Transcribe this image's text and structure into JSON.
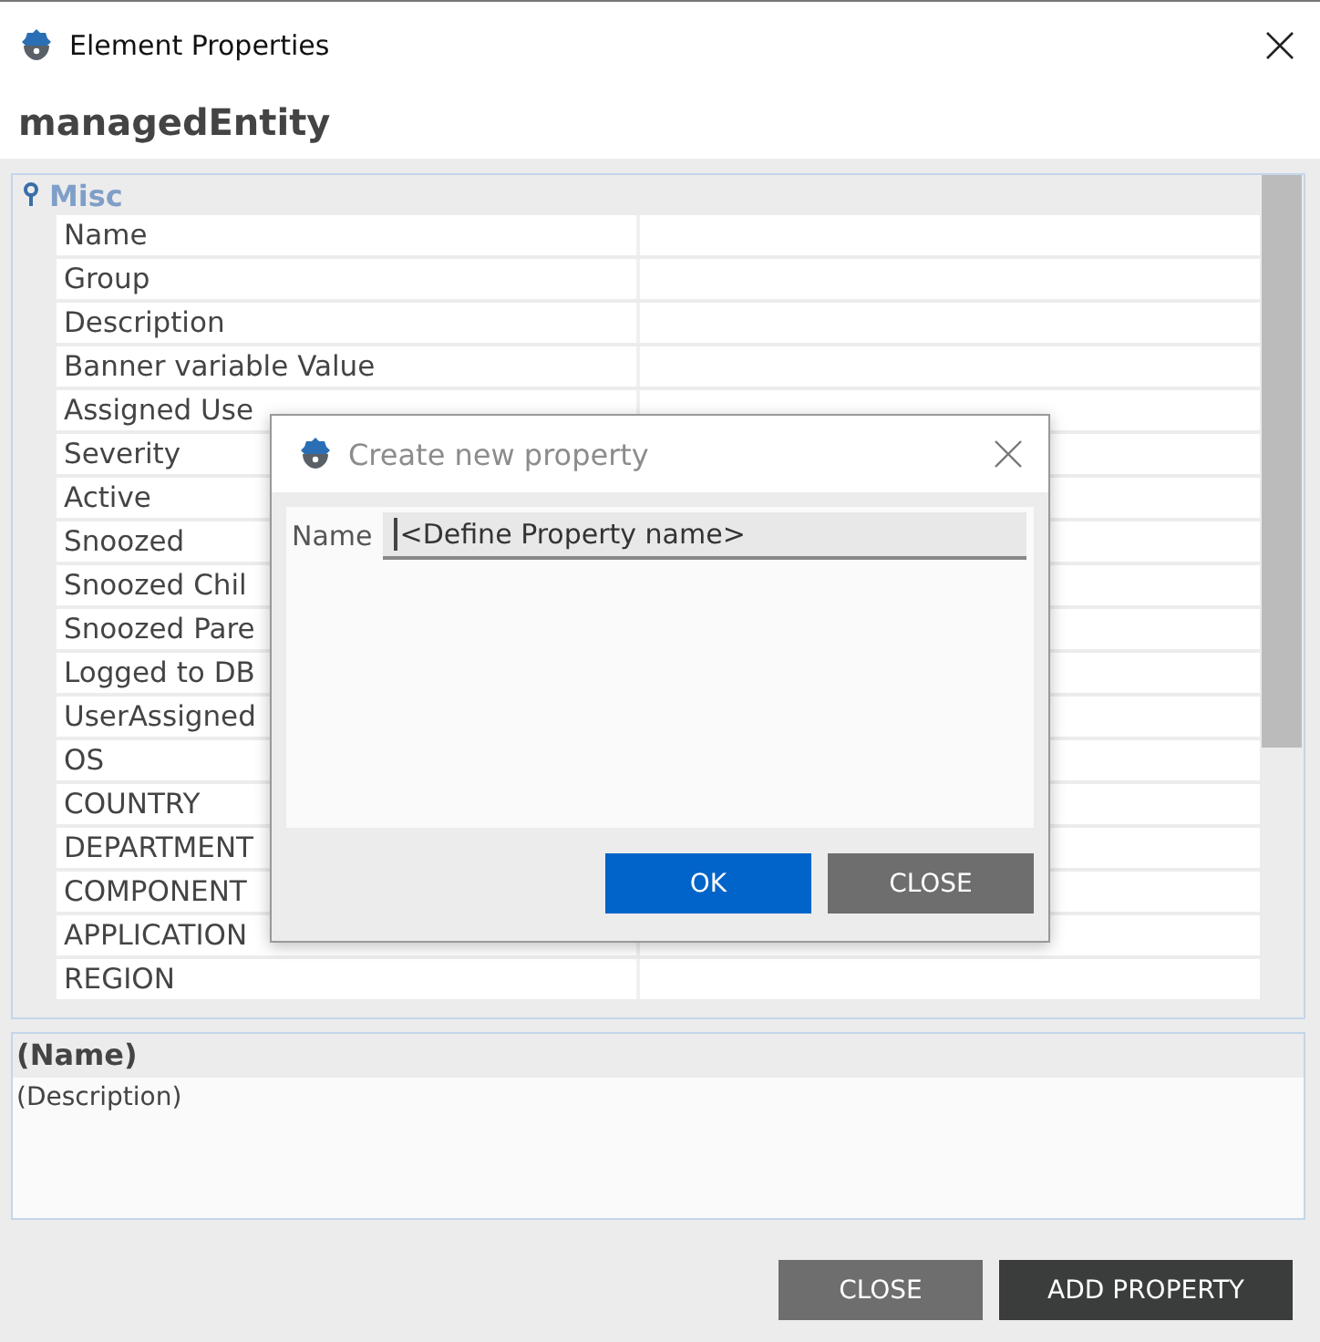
{
  "window": {
    "title": "Element Properties",
    "heading": "managedEntity"
  },
  "property_grid": {
    "category": "Misc",
    "rows": [
      {
        "name": "Name"
      },
      {
        "name": "Group"
      },
      {
        "name": "Description"
      },
      {
        "name": "Banner variable Value"
      },
      {
        "name": "Assigned Use"
      },
      {
        "name": "Severity"
      },
      {
        "name": "Active"
      },
      {
        "name": "Snoozed"
      },
      {
        "name": "Snoozed Chil"
      },
      {
        "name": "Snoozed Pare"
      },
      {
        "name": "Logged to DB"
      },
      {
        "name": "UserAssigned"
      },
      {
        "name": "OS"
      },
      {
        "name": "COUNTRY"
      },
      {
        "name": "DEPARTMENT"
      },
      {
        "name": "COMPONENT"
      },
      {
        "name": "APPLICATION"
      },
      {
        "name": "REGION"
      }
    ]
  },
  "description_panel": {
    "title": "(Name)",
    "text": "(Description)"
  },
  "buttons": [
    {
      "label": "CLOSE",
      "kind": "secondary"
    },
    {
      "label": "ADD PROPERTY",
      "kind": "primary"
    }
  ],
  "dialog": {
    "title": "Create new property",
    "field_label": "Name",
    "field_value": "<Define Property name>",
    "buttons": [
      {
        "label": "OK",
        "kind": "accent"
      },
      {
        "label": "CLOSE",
        "kind": "secondary"
      }
    ]
  }
}
